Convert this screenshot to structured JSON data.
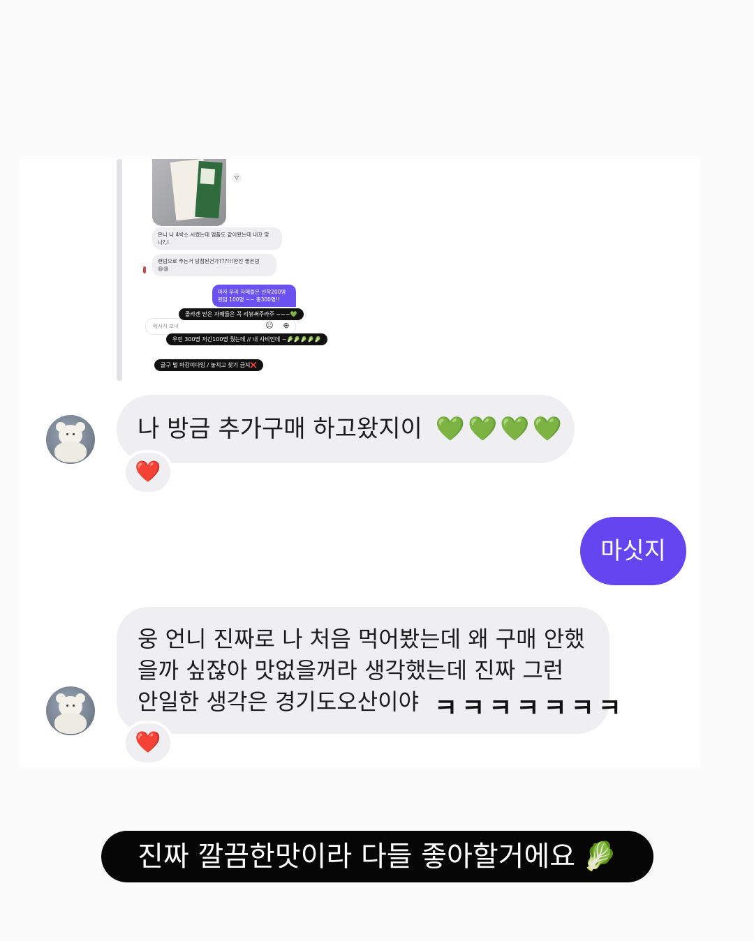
{
  "embedded_chat": {
    "message_1": "온니 나 4박스 시켰는데 엠플도 같이왔는데 내꼬 맞나?,!",
    "message_2": "랜덤으로 주는거 당첨된건가???!!!완전 좋은뎅",
    "message_2_emoji": "😍😍",
    "sent_message": "마자 우리 자매들은 선착200명 랜덤 100명 ~~ 총300명!!",
    "input_placeholder": "메시지 보내",
    "sticker_1": "콜라겐 받은 자매들은 꼭 리뷰써주라주 ~~~💚",
    "sticker_2": "우린 300명 저긴100명 줬는데 // 내 사비인데 ~🥬🥬🥬🥬🥬",
    "sticker_3": "글구 벌 마감이다잉 / 놓치고 찾기 금지❌"
  },
  "messages": [
    {
      "side": "received",
      "text": "나 방금 추가구매 하고왔지이",
      "emoji": "💚💚💚💚",
      "reaction": "❤️"
    },
    {
      "side": "sent",
      "text": "마싯지"
    },
    {
      "side": "received",
      "text_line_1": "웅 언니 진짜로 나 처음 먹어봤는데 왜 구매 안했",
      "text_line_2": "을까 싶잖아 맛없을꺼라 생각했는데 진짜 그런",
      "text_line_3": "안일한 생각은 경기도오산이야",
      "laugh": "ㅋㅋㅋㅋㅋㅋㅋ",
      "reaction": "❤️"
    }
  ],
  "caption": {
    "text": "진짜 깔끔한맛이라 다들 좋아할거에요",
    "emoji": "🥬"
  },
  "icons": [
    "forward-icon",
    "sticker-icon",
    "plus-circle-icon",
    "heart-reaction-icon",
    "green-heart-icon",
    "leafy-green-icon"
  ],
  "colors": {
    "sent_bubble": "#6445ef",
    "received_bubble": "#efeff2",
    "caption_bg": "#060606"
  }
}
